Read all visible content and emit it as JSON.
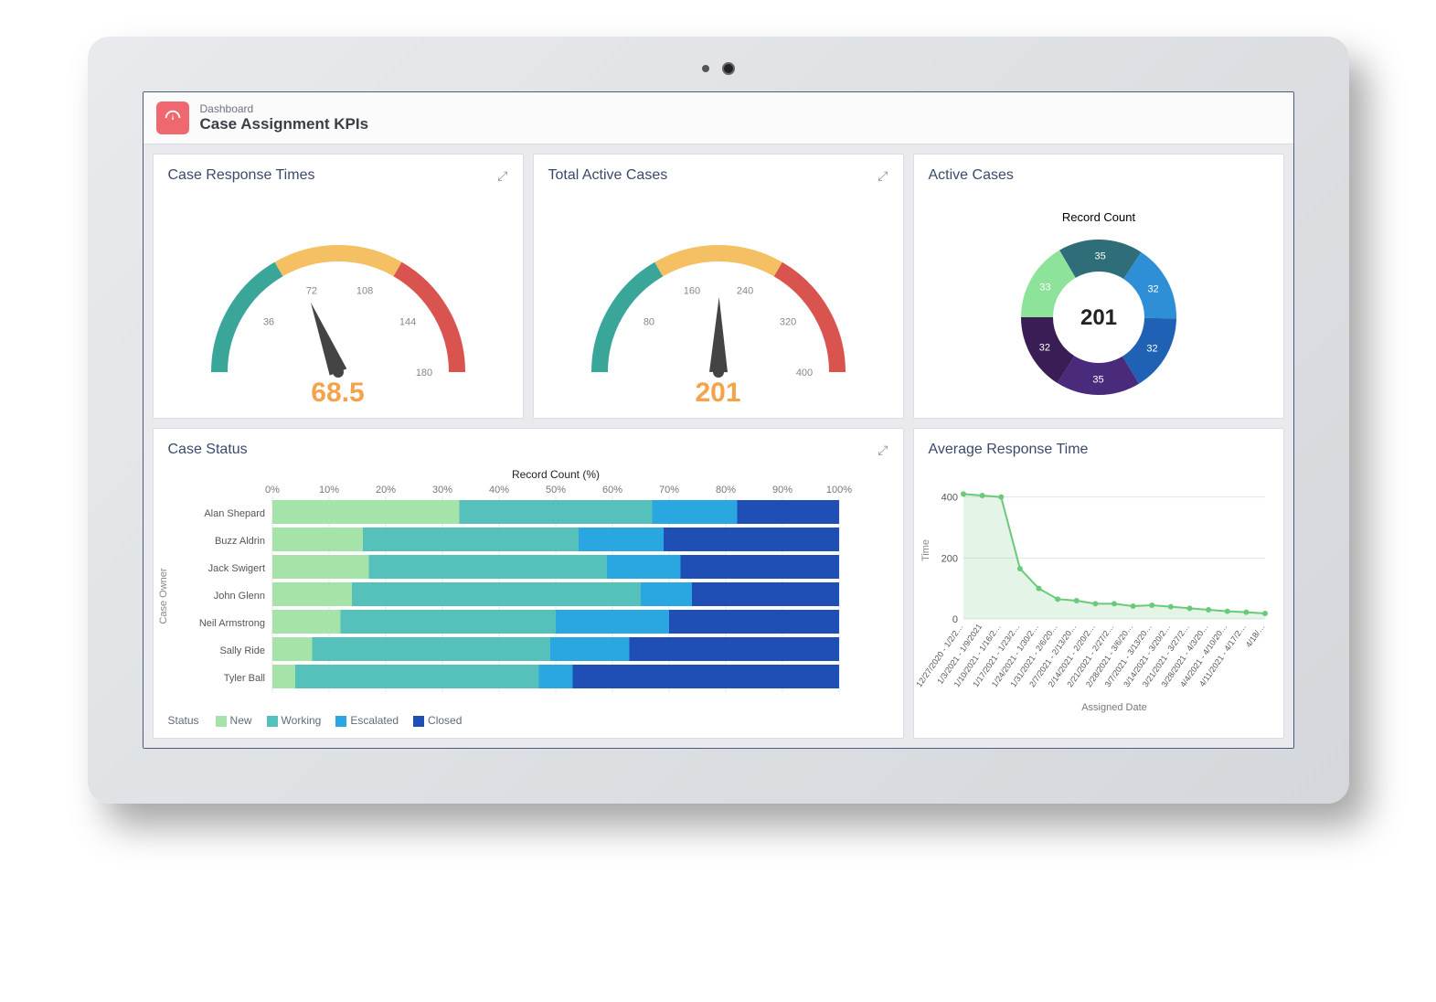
{
  "header": {
    "subtitle": "Dashboard",
    "title": "Case Assignment KPIs"
  },
  "cards": {
    "response_times": {
      "title": "Case Response Times"
    },
    "active_cases": {
      "title": "Total Active Cases"
    },
    "donut": {
      "title": "Active Cases",
      "subtitle": "Record Count"
    },
    "status": {
      "title": "Case Status",
      "axis": "Record Count (%)",
      "yaxis": "Case Owner",
      "legend_title": "Status"
    },
    "avg": {
      "title": "Average Response Time",
      "xlabel": "Assigned Date",
      "ylabel": "Time"
    }
  },
  "chart_data": [
    {
      "id": "gauge_response",
      "type": "gauge",
      "title": "Case Response Times",
      "value": 68.5,
      "min": 0,
      "max": 180,
      "ticks": [
        36,
        72,
        108,
        144,
        180
      ],
      "bands": [
        {
          "from": 0,
          "to": 60,
          "color": "#3aa699"
        },
        {
          "from": 60,
          "to": 120,
          "color": "#f5c063"
        },
        {
          "from": 120,
          "to": 180,
          "color": "#d9544f"
        }
      ]
    },
    {
      "id": "gauge_active",
      "type": "gauge",
      "title": "Total Active Cases",
      "value": 201,
      "min": 0,
      "max": 400,
      "ticks": [
        80,
        160,
        240,
        320,
        400
      ],
      "bands": [
        {
          "from": 0,
          "to": 133,
          "color": "#3aa699"
        },
        {
          "from": 133,
          "to": 267,
          "color": "#f5c063"
        },
        {
          "from": 267,
          "to": 400,
          "color": "#d9544f"
        }
      ]
    },
    {
      "id": "donut_active",
      "type": "pie",
      "title": "Active Cases — Record Count",
      "center_value": 201,
      "slices": [
        {
          "label": "33",
          "value": 33,
          "color": "#8ee39b"
        },
        {
          "label": "35",
          "value": 35,
          "color": "#2f6e78"
        },
        {
          "label": "32",
          "value": 32,
          "color": "#2e8fd6"
        },
        {
          "label": "32",
          "value": 32,
          "color": "#1f62b5"
        },
        {
          "label": "35",
          "value": 35,
          "color": "#4a2a7b"
        },
        {
          "label": "32",
          "value": 32,
          "color": "#3a1d55"
        }
      ]
    },
    {
      "id": "stacked_status",
      "type": "bar",
      "title": "Case Status",
      "xlabel": "Record Count (%)",
      "ylabel": "Case Owner",
      "x_ticks": [
        0,
        10,
        20,
        30,
        40,
        50,
        60,
        70,
        80,
        90,
        100
      ],
      "categories": [
        "Alan Shepard",
        "Buzz Aldrin",
        "Jack Swigert",
        "John Glenn",
        "Neil Armstrong",
        "Sally Ride",
        "Tyler Ball"
      ],
      "series": [
        {
          "name": "New",
          "color": "#a5e3a8",
          "values": [
            33,
            16,
            17,
            14,
            12,
            7,
            4
          ]
        },
        {
          "name": "Working",
          "color": "#55c1ba",
          "values": [
            34,
            38,
            42,
            51,
            38,
            42,
            43
          ]
        },
        {
          "name": "Escalated",
          "color": "#2aa6e1",
          "values": [
            15,
            15,
            13,
            9,
            20,
            14,
            6
          ]
        },
        {
          "name": "Closed",
          "color": "#1f4fb4",
          "values": [
            18,
            31,
            28,
            26,
            30,
            37,
            47
          ]
        }
      ]
    },
    {
      "id": "avg_response",
      "type": "line",
      "title": "Average Response Time",
      "xlabel": "Assigned Date",
      "ylabel": "Time",
      "ylim": [
        0,
        450
      ],
      "y_ticks": [
        0,
        200,
        400
      ],
      "x": [
        "12/27/2020 - 1/2/2…",
        "1/3/2021 - 1/9/2021",
        "1/10/2021 - 1/16/2…",
        "1/17/2021 - 1/23/2…",
        "1/24/2021 - 1/30/2…",
        "1/31/2021 - 2/6/20…",
        "2/7/2021 - 2/13/20…",
        "2/14/2021 - 2/20/2…",
        "2/21/2021 - 2/27/2…",
        "2/28/2021 - 3/6/20…",
        "3/7/2021 - 3/13/20…",
        "3/14/2021 - 3/20/2…",
        "3/21/2021 - 3/27/2…",
        "3/28/2021 - 4/3/20…",
        "4/4/2021 - 4/10/20…",
        "4/11/2021 - 4/17/2…",
        "4/18/…"
      ],
      "values": [
        410,
        405,
        400,
        165,
        100,
        65,
        60,
        50,
        50,
        42,
        45,
        40,
        35,
        30,
        25,
        22,
        18
      ],
      "color": "#6ac97a"
    }
  ]
}
